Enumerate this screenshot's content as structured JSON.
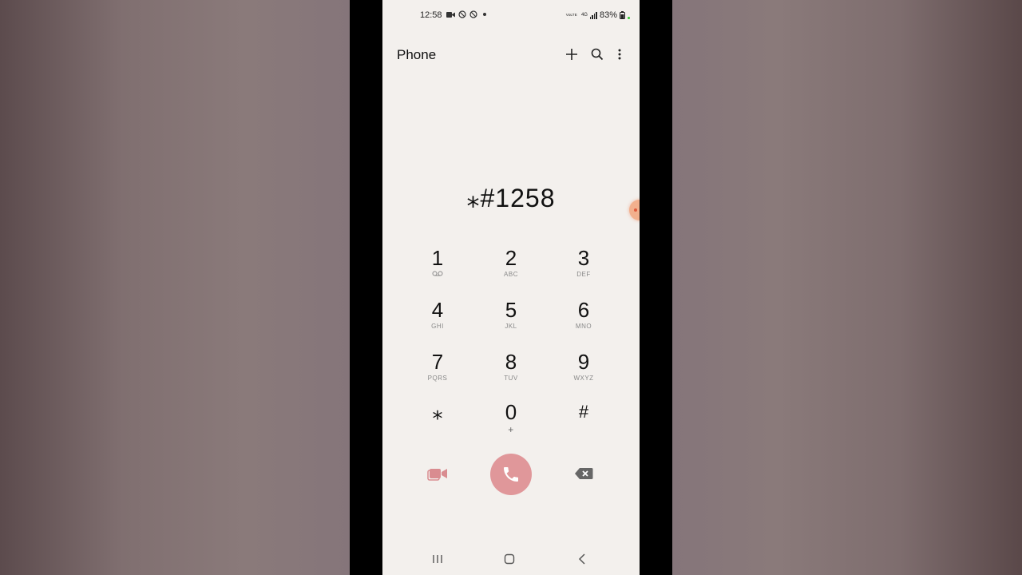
{
  "status_bar": {
    "time": "12:58",
    "left_icons": [
      "video-record-icon",
      "nfc-icon",
      "nfc-icon",
      "dot-icon"
    ],
    "net_label_top": "VoLTE",
    "net_label_4g": "4G",
    "battery": "83%"
  },
  "app_bar": {
    "title": "Phone",
    "actions": [
      "add-icon",
      "search-icon",
      "more-options-icon"
    ]
  },
  "dialer": {
    "dialed_number": "⁎#1258"
  },
  "keypad": [
    {
      "digit": "1",
      "sub": "voicemail-icon"
    },
    {
      "digit": "2",
      "sub": "ABC"
    },
    {
      "digit": "3",
      "sub": "DEF"
    },
    {
      "digit": "4",
      "sub": "GHI"
    },
    {
      "digit": "5",
      "sub": "JKL"
    },
    {
      "digit": "6",
      "sub": "MNO"
    },
    {
      "digit": "7",
      "sub": "PQRS"
    },
    {
      "digit": "8",
      "sub": "TUV"
    },
    {
      "digit": "9",
      "sub": "WXYZ"
    },
    {
      "digit": "⁎",
      "sub": ""
    },
    {
      "digit": "0",
      "sub": "+"
    },
    {
      "digit": "#",
      "sub": ""
    }
  ],
  "colors": {
    "background": "#f3f0ed",
    "accent": "#e0979a",
    "video_icon": "#d98c90",
    "backspace_icon": "#666666"
  },
  "nav_bar": [
    "recent-apps-icon",
    "home-icon",
    "back-icon"
  ]
}
